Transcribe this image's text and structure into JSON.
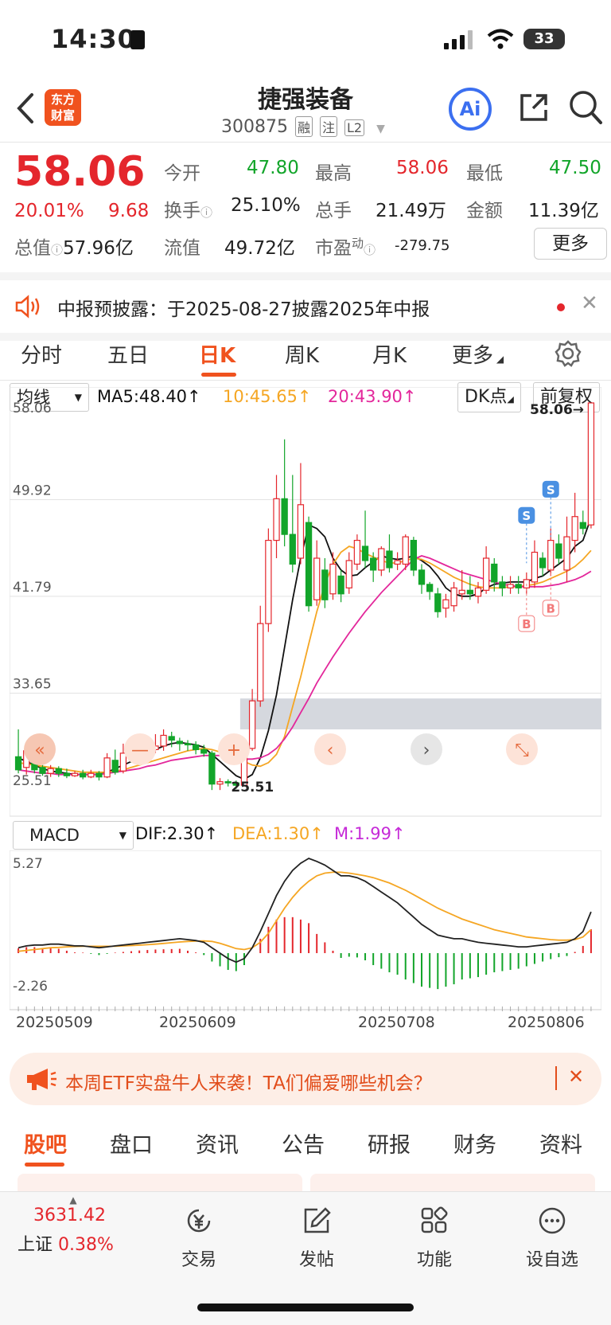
{
  "status_bar": {
    "time": "14:30",
    "battery": "33"
  },
  "header": {
    "title": "捷强装备",
    "code": "300875",
    "tags": [
      "融",
      "注",
      "L2"
    ],
    "logo_text": [
      "东方",
      "财富"
    ],
    "ai_label": "Ai"
  },
  "quote": {
    "price": "58.06",
    "change_pct": "20.01%",
    "change_amt": "9.68",
    "fields": {
      "open_label": "今开",
      "open": "47.80",
      "high_label": "最高",
      "high": "58.06",
      "low_label": "最低",
      "low": "47.50",
      "turnover_label": "换手",
      "turnover": "25.10%",
      "volume_label": "总手",
      "volume": "21.49万",
      "amount_label": "金额",
      "amount": "11.39亿",
      "mktcap_label": "总值",
      "mktcap": "57.96亿",
      "float_label": "流值",
      "float": "49.72亿",
      "pe_label": "市盈",
      "pe_sup": "动",
      "pe": "-279.75"
    },
    "more_label": "更多"
  },
  "notice": {
    "text": "中报预披露：于2025-08-27披露2025年中报"
  },
  "chart_tabs": [
    "分时",
    "五日",
    "日K",
    "周K",
    "月K",
    "更多"
  ],
  "chart_tabs_active": "日K",
  "chart_toolbar": {
    "indicator": "均线",
    "ma5": "MA5:48.40↑",
    "ma10": "10:45.65↑",
    "ma20": "20:43.90↑",
    "dk_label": "DK点",
    "adjust_label": "前复权"
  },
  "chart_data": [
    {
      "type": "candlestick",
      "y_ticks": [
        "58.06",
        "49.92",
        "41.79",
        "33.65",
        "25.51"
      ],
      "ylim": [
        25.51,
        58.06
      ],
      "high_marker": "58.06→",
      "low_marker": "25.51",
      "series_colors": {
        "up": "#e4262c",
        "down": "#12a52a",
        "MA5": "#111111",
        "MA10": "#f5a623",
        "MA20": "#e3279b"
      },
      "candles": [
        [
          28.3,
          27.2,
          30.6,
          26.9
        ],
        [
          27.4,
          28.8,
          29.5,
          26.8
        ],
        [
          28.6,
          27.2,
          28.9,
          26.9
        ],
        [
          27.4,
          26.9,
          27.6,
          26.7
        ],
        [
          26.9,
          27.3,
          27.6,
          26.6
        ],
        [
          27.3,
          26.9,
          27.5,
          26.6
        ],
        [
          26.9,
          26.7,
          27.3,
          26.5
        ],
        [
          26.7,
          26.9,
          27.1,
          26.6
        ],
        [
          26.9,
          26.6,
          27.2,
          26.4
        ],
        [
          26.6,
          26.9,
          27.2,
          26.5
        ],
        [
          26.9,
          26.6,
          27.1,
          26.3
        ],
        [
          26.6,
          28.2,
          28.6,
          26.5
        ],
        [
          28.0,
          27.0,
          28.9,
          26.8
        ],
        [
          27.1,
          28.6,
          29.4,
          26.9
        ],
        [
          28.6,
          28.3,
          29.8,
          27.8
        ],
        [
          28.4,
          29.4,
          30.0,
          28.0
        ],
        [
          29.3,
          28.9,
          29.8,
          28.2
        ],
        [
          28.9,
          29.2,
          30.2,
          28.6
        ],
        [
          29.2,
          30.1,
          30.6,
          28.8
        ],
        [
          30.0,
          29.7,
          30.4,
          29.1
        ],
        [
          29.6,
          29.4,
          29.9,
          28.8
        ],
        [
          29.4,
          29.3,
          29.7,
          28.8
        ],
        [
          29.3,
          28.9,
          29.6,
          28.5
        ],
        [
          28.9,
          28.6,
          29.3,
          28.3
        ],
        [
          28.6,
          26.0,
          28.8,
          25.5
        ],
        [
          26.0,
          26.2,
          26.5,
          25.5
        ],
        [
          26.2,
          26.1,
          26.4,
          25.8
        ],
        [
          26.1,
          25.9,
          26.3,
          25.6
        ],
        [
          25.9,
          29.0,
          29.5,
          25.8
        ],
        [
          29.0,
          33.0,
          34.0,
          28.8
        ],
        [
          33.0,
          39.5,
          41.0,
          32.5
        ],
        [
          39.5,
          46.5,
          47.5,
          38.8
        ],
        [
          46.5,
          50.0,
          52.0,
          45.0
        ],
        [
          50.0,
          47.0,
          55.0,
          46.0
        ],
        [
          47.0,
          44.5,
          52.0,
          43.8
        ],
        [
          45.0,
          49.5,
          53.0,
          44.5
        ],
        [
          48.0,
          41.0,
          48.5,
          40.5
        ],
        [
          41.5,
          45.0,
          46.5,
          41.0
        ],
        [
          44.0,
          41.5,
          45.0,
          40.8
        ],
        [
          42.0,
          44.5,
          45.5,
          41.5
        ],
        [
          43.5,
          42.0,
          44.0,
          41.3
        ],
        [
          42.5,
          44.8,
          45.5,
          42.0
        ],
        [
          44.5,
          46.5,
          47.0,
          44.0
        ],
        [
          46.0,
          44.8,
          49.0,
          44.2
        ],
        [
          45.0,
          44.0,
          45.5,
          43.0
        ],
        [
          44.0,
          45.8,
          46.0,
          43.5
        ],
        [
          45.6,
          44.2,
          47.0,
          43.8
        ],
        [
          44.5,
          44.8,
          45.5,
          44.0
        ],
        [
          44.5,
          46.8,
          47.0,
          44.0
        ],
        [
          46.5,
          44.0,
          46.8,
          43.5
        ],
        [
          44.0,
          42.8,
          44.5,
          42.0
        ],
        [
          42.8,
          42.2,
          43.0,
          41.5
        ],
        [
          42.0,
          40.5,
          42.5,
          40.0
        ],
        [
          40.8,
          41.5,
          42.0,
          40.0
        ],
        [
          41.0,
          42.5,
          43.0,
          40.5
        ],
        [
          42.0,
          42.3,
          44.0,
          41.5
        ],
        [
          42.3,
          42.0,
          43.5,
          41.5
        ],
        [
          41.8,
          42.5,
          43.0,
          41.2
        ],
        [
          42.3,
          45.0,
          46.0,
          42.0
        ],
        [
          44.5,
          43.0,
          45.0,
          42.2
        ],
        [
          43.0,
          42.5,
          43.5,
          41.8
        ],
        [
          42.5,
          42.8,
          43.5,
          42.0
        ],
        [
          42.8,
          42.5,
          43.5,
          42.0
        ],
        [
          42.5,
          43.2,
          43.8,
          42.0
        ],
        [
          43.0,
          45.5,
          46.5,
          42.5
        ],
        [
          45.0,
          44.2,
          45.5,
          43.5
        ],
        [
          44.0,
          46.5,
          47.5,
          43.5
        ],
        [
          46.2,
          45.0,
          47.0,
          44.5
        ],
        [
          44.0,
          46.8,
          48.5,
          43.0
        ],
        [
          46.5,
          48.5,
          50.5,
          45.5
        ],
        [
          48.0,
          47.5,
          49.0,
          47.0
        ],
        [
          47.8,
          58.06,
          58.06,
          47.5
        ]
      ],
      "ma5": [
        28.2,
        27.9,
        27.6,
        27.3,
        27.1,
        27.0,
        26.9,
        26.8,
        26.8,
        26.8,
        26.8,
        27.0,
        27.3,
        27.6,
        27.9,
        28.3,
        28.6,
        28.9,
        29.2,
        29.4,
        29.5,
        29.4,
        29.3,
        29.1,
        28.5,
        27.9,
        27.3,
        26.7,
        26.4,
        26.8,
        28.2,
        30.5,
        33.5,
        37.5,
        41.5,
        45.0,
        47.8,
        47.5,
        46.8,
        45.0,
        44.0,
        43.5,
        43.6,
        44.2,
        44.7,
        45.2,
        45.0,
        44.9,
        45.0,
        45.2,
        44.8,
        44.3,
        43.5,
        42.5,
        42.0,
        41.8,
        41.8,
        42.0,
        42.5,
        42.8,
        42.9,
        43.0,
        43.0,
        43.0,
        43.3,
        43.5,
        44.0,
        44.5,
        45.0,
        46.0,
        46.5,
        48.4
      ],
      "ma10": [
        27.8,
        27.7,
        27.6,
        27.5,
        27.4,
        27.3,
        27.2,
        27.1,
        27.0,
        27.0,
        27.0,
        27.0,
        27.1,
        27.2,
        27.4,
        27.6,
        27.8,
        28.0,
        28.2,
        28.4,
        28.6,
        28.8,
        28.9,
        29.0,
        28.9,
        28.7,
        28.5,
        28.2,
        27.9,
        27.6,
        27.5,
        27.8,
        28.5,
        30.0,
        32.5,
        35.0,
        37.8,
        40.5,
        42.8,
        44.5,
        45.5,
        46.0,
        45.8,
        45.4,
        45.1,
        44.8,
        44.6,
        44.6,
        44.8,
        45.0,
        44.9,
        44.6,
        44.2,
        43.8,
        43.4,
        43.1,
        42.8,
        42.6,
        42.5,
        42.5,
        42.5,
        42.6,
        42.6,
        42.7,
        42.8,
        43.0,
        43.3,
        43.6,
        43.9,
        44.3,
        44.9,
        45.65
      ],
      "ma20": [
        27.2,
        27.1,
        27.0,
        26.9,
        26.9,
        26.8,
        26.8,
        26.8,
        26.8,
        26.8,
        26.8,
        26.9,
        27.0,
        27.1,
        27.2,
        27.3,
        27.5,
        27.6,
        27.8,
        28.0,
        28.1,
        28.2,
        28.3,
        28.4,
        28.4,
        28.4,
        28.3,
        28.2,
        28.1,
        28.1,
        28.2,
        28.5,
        29.0,
        29.8,
        30.8,
        32.0,
        33.2,
        34.5,
        35.6,
        36.7,
        37.7,
        38.7,
        39.6,
        40.5,
        41.3,
        42.1,
        42.8,
        43.5,
        44.2,
        44.9,
        45.2,
        45.0,
        44.7,
        44.4,
        44.1,
        43.8,
        43.6,
        43.4,
        43.2,
        43.0,
        42.8,
        42.7,
        42.6,
        42.6,
        42.6,
        42.6,
        42.7,
        42.8,
        43.0,
        43.2,
        43.5,
        43.9
      ],
      "signals": [
        {
          "label": "S",
          "type": "sell"
        },
        {
          "label": "S",
          "type": "sell"
        },
        {
          "label": "B",
          "type": "buy"
        },
        {
          "label": "B",
          "type": "buy"
        }
      ]
    },
    {
      "type": "bar",
      "name": "MACD",
      "y_ticks": [
        "5.27",
        "-2.26"
      ],
      "ylim": [
        -2.26,
        5.27
      ],
      "dif": [
        0.3,
        0.4,
        0.45,
        0.45,
        0.5,
        0.5,
        0.45,
        0.4,
        0.4,
        0.35,
        0.3,
        0.35,
        0.4,
        0.45,
        0.5,
        0.55,
        0.6,
        0.65,
        0.7,
        0.75,
        0.8,
        0.75,
        0.7,
        0.6,
        0.3,
        0.0,
        -0.3,
        -0.5,
        -0.3,
        0.3,
        1.2,
        2.2,
        3.2,
        4.0,
        4.6,
        5.0,
        5.27,
        5.1,
        4.9,
        4.6,
        4.3,
        4.3,
        4.2,
        4.0,
        3.7,
        3.4,
        3.1,
        2.8,
        2.4,
        2.0,
        1.6,
        1.3,
        1.0,
        0.9,
        0.8,
        0.8,
        0.7,
        0.6,
        0.55,
        0.5,
        0.45,
        0.4,
        0.35,
        0.35,
        0.4,
        0.45,
        0.5,
        0.55,
        0.6,
        0.8,
        1.2,
        2.3
      ],
      "dea": [
        0.1,
        0.15,
        0.2,
        0.25,
        0.3,
        0.32,
        0.35,
        0.37,
        0.38,
        0.38,
        0.38,
        0.38,
        0.38,
        0.4,
        0.42,
        0.44,
        0.47,
        0.5,
        0.54,
        0.58,
        0.62,
        0.65,
        0.67,
        0.68,
        0.65,
        0.55,
        0.4,
        0.25,
        0.2,
        0.3,
        0.6,
        1.1,
        1.8,
        2.5,
        3.1,
        3.6,
        4.0,
        4.3,
        4.45,
        4.5,
        4.5,
        4.45,
        4.38,
        4.3,
        4.2,
        4.05,
        3.9,
        3.7,
        3.5,
        3.25,
        3.0,
        2.75,
        2.5,
        2.3,
        2.1,
        1.9,
        1.75,
        1.6,
        1.45,
        1.3,
        1.2,
        1.1,
        1.0,
        0.9,
        0.85,
        0.8,
        0.75,
        0.72,
        0.72,
        0.75,
        0.9,
        1.3
      ],
      "m": [
        0.4,
        0.5,
        0.5,
        0.4,
        0.4,
        0.36,
        0.2,
        0.06,
        0.04,
        -0.06,
        -0.16,
        -0.06,
        0.04,
        0.1,
        0.16,
        0.22,
        0.26,
        0.3,
        0.32,
        0.34,
        0.36,
        0.2,
        0.06,
        -0.16,
        -0.7,
        -1.1,
        -1.4,
        -1.5,
        -1.0,
        0.0,
        1.2,
        2.2,
        2.8,
        3.0,
        3.0,
        2.8,
        2.5,
        1.6,
        0.9,
        0.2,
        -0.4,
        -0.3,
        -0.36,
        -0.6,
        -1.0,
        -1.3,
        -1.6,
        -1.8,
        -2.2,
        -2.5,
        -2.8,
        -2.9,
        -3.0,
        -2.8,
        -2.6,
        -2.2,
        -2.1,
        -2.0,
        -1.8,
        -1.6,
        -1.5,
        -1.4,
        -1.3,
        -1.1,
        -0.9,
        -0.7,
        -0.5,
        -0.34,
        -0.24,
        0.1,
        0.6,
        1.99
      ],
      "colors": {
        "dif": "#222222",
        "dea": "#f5a623",
        "up": "#e4262c",
        "down": "#12a52a"
      },
      "x_labels": [
        "20250509",
        "20250609",
        "20250708",
        "20250806"
      ]
    }
  ],
  "macd_toolbar": {
    "indicator": "MACD",
    "dif": "DIF:2.30↑",
    "dea": "DEA:1.30↑",
    "m": "M:1.99↑"
  },
  "chart_overlay_buttons": [
    "«",
    "—",
    "+",
    "‹",
    "›",
    "⤡"
  ],
  "banner": {
    "text": "本周ETF实盘牛人来袭！TA们偏爱哪些机会？"
  },
  "bottom_tabs": [
    "股吧",
    "盘口",
    "资讯",
    "公告",
    "研报",
    "财务",
    "资料"
  ],
  "bottom_tabs_active": "股吧",
  "footer": {
    "index_value": "3631.42",
    "index_name": "上证",
    "index_change": "0.38%",
    "buttons": [
      "交易",
      "发帖",
      "功能",
      "设自选"
    ]
  }
}
